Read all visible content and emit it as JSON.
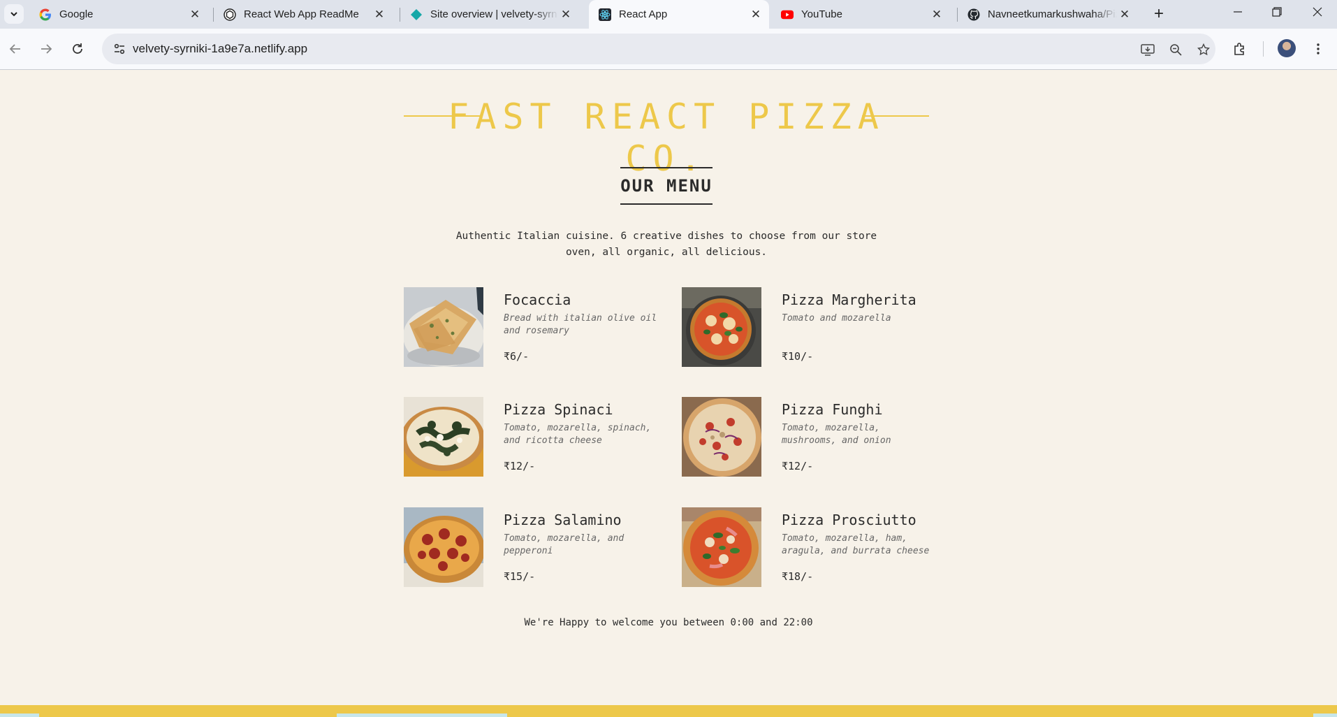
{
  "browser": {
    "tabs": [
      {
        "title": "Google",
        "icon": "google-icon"
      },
      {
        "title": "React Web App ReadMe",
        "icon": "openai-icon"
      },
      {
        "title": "Site overview | velvety-syrniki",
        "icon": "netlify-icon"
      },
      {
        "title": "React App",
        "icon": "react-icon",
        "active": true
      },
      {
        "title": "YouTube",
        "icon": "youtube-icon"
      },
      {
        "title": "Navneetkumarkushwaha/Pizza",
        "icon": "github-icon"
      }
    ],
    "url": "velvety-syrniki-1a9e7a.netlify.app"
  },
  "page": {
    "logo": "FAST REACT PIZZA CO.",
    "menu_heading": "OUR MENU",
    "intro": "Authentic Italian cuisine. 6 creative dishes to choose from our store oven, all organic, all delicious.",
    "pizzas": [
      {
        "name": "Focaccia",
        "ingredients": "Bread with italian olive oil and rosemary",
        "price": "₹6/-"
      },
      {
        "name": "Pizza Margherita",
        "ingredients": "Tomato and mozarella",
        "price": "₹10/-"
      },
      {
        "name": "Pizza Spinaci",
        "ingredients": "Tomato, mozarella, spinach, and ricotta cheese",
        "price": "₹12/-"
      },
      {
        "name": "Pizza Funghi",
        "ingredients": "Tomato, mozarella, mushrooms, and onion",
        "price": "₹12/-"
      },
      {
        "name": "Pizza Salamino",
        "ingredients": "Tomato, mozarella, and pepperoni",
        "price": "₹15/-"
      },
      {
        "name": "Pizza Prosciutto",
        "ingredients": "Tomato, mozarella, ham, aragula, and burrata cheese",
        "price": "₹18/-"
      }
    ],
    "footer": "We're Happy to welcome you between 0:00 and 22:00"
  },
  "colors": {
    "accent": "#edc84a",
    "background": "#f7f2e9",
    "text": "#2b2b2b"
  }
}
